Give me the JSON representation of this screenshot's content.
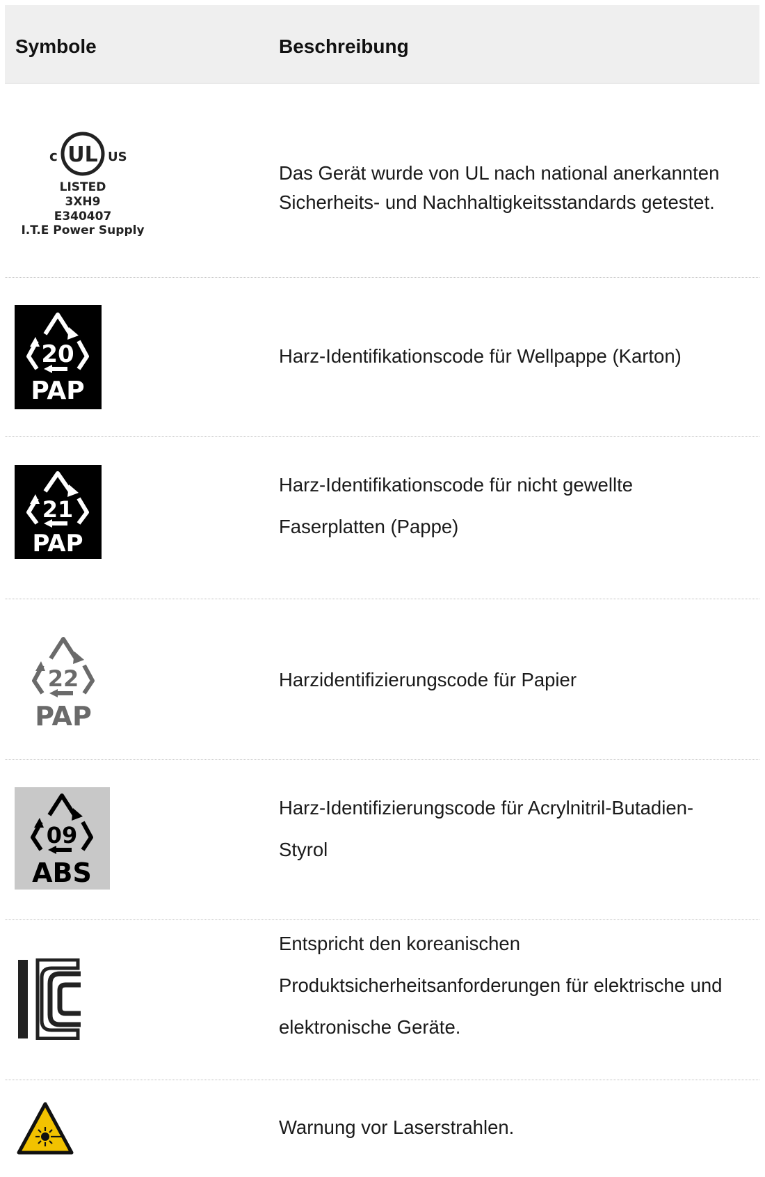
{
  "header": {
    "symbols_label": "Symbole",
    "description_label": "Beschreibung"
  },
  "rows": [
    {
      "icon": "ul-listed-mark-icon",
      "mark": {
        "left": "c",
        "center": "UL",
        "right": "US",
        "lines": [
          "LISTED",
          "3XH9",
          "E340407",
          "I.T.E Power Supply"
        ]
      },
      "description": [
        "Das Gerät wurde von UL nach national anerkannten",
        "Sicherheits- und Nachhaltigkeitsstandards getestet."
      ]
    },
    {
      "icon": "recycling-20-pap-icon",
      "mark": {
        "number": "20",
        "material": "PAP"
      },
      "description": [
        "Harz-Identifikationscode für Wellpappe (Karton)"
      ]
    },
    {
      "icon": "recycling-21-pap-icon",
      "mark": {
        "number": "21",
        "material": "PAP"
      },
      "description": [
        "Harz-Identifikationscode für nicht gewellte",
        "Faserplatten (Pappe)"
      ]
    },
    {
      "icon": "recycling-22-pap-icon",
      "mark": {
        "number": "22",
        "material": "PAP"
      },
      "description": [
        "Harzidentifizierungscode für Papier"
      ]
    },
    {
      "icon": "recycling-09-abs-icon",
      "mark": {
        "number": "09",
        "material": "ABS"
      },
      "description": [
        "Harz-Identifizierungscode für Acrylnitril-Butadien-",
        "Styrol"
      ]
    },
    {
      "icon": "kc-mark-icon",
      "description": [
        "Entspricht den koreanischen",
        "Produktsicherheitsanforderungen für elektrische und",
        "elektronische Geräte."
      ]
    },
    {
      "icon": "laser-warning-icon",
      "description": [
        "Warnung vor Laserstrahlen."
      ]
    }
  ],
  "colors": {
    "header_bg": "#efefef",
    "laser_yellow": "#f2c200",
    "abs_bg": "#c8c8c8"
  }
}
